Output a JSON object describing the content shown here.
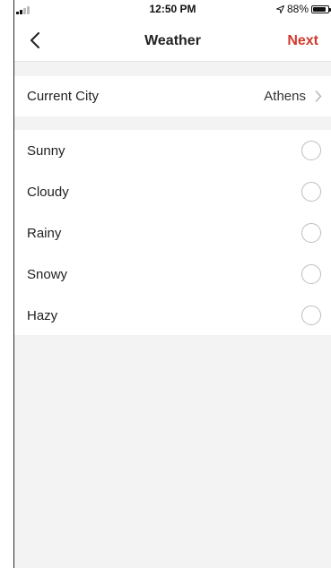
{
  "status_bar": {
    "time": "12:50 PM",
    "battery": "88%",
    "battery_level": 0.88,
    "icons": [
      "signal-icon",
      "location-arrow-icon",
      "battery-icon"
    ]
  },
  "nav": {
    "title": "Weather",
    "next_label": "Next",
    "back_icon": "chevron-left-icon"
  },
  "city": {
    "label": "Current City",
    "value": "Athens"
  },
  "weather_options": [
    {
      "label": "Sunny",
      "selected": false
    },
    {
      "label": "Cloudy",
      "selected": false
    },
    {
      "label": "Rainy",
      "selected": false
    },
    {
      "label": "Snowy",
      "selected": false
    },
    {
      "label": "Hazy",
      "selected": false
    }
  ],
  "colors": {
    "accent": "#d23a2e",
    "background": "#f3f3f3"
  }
}
